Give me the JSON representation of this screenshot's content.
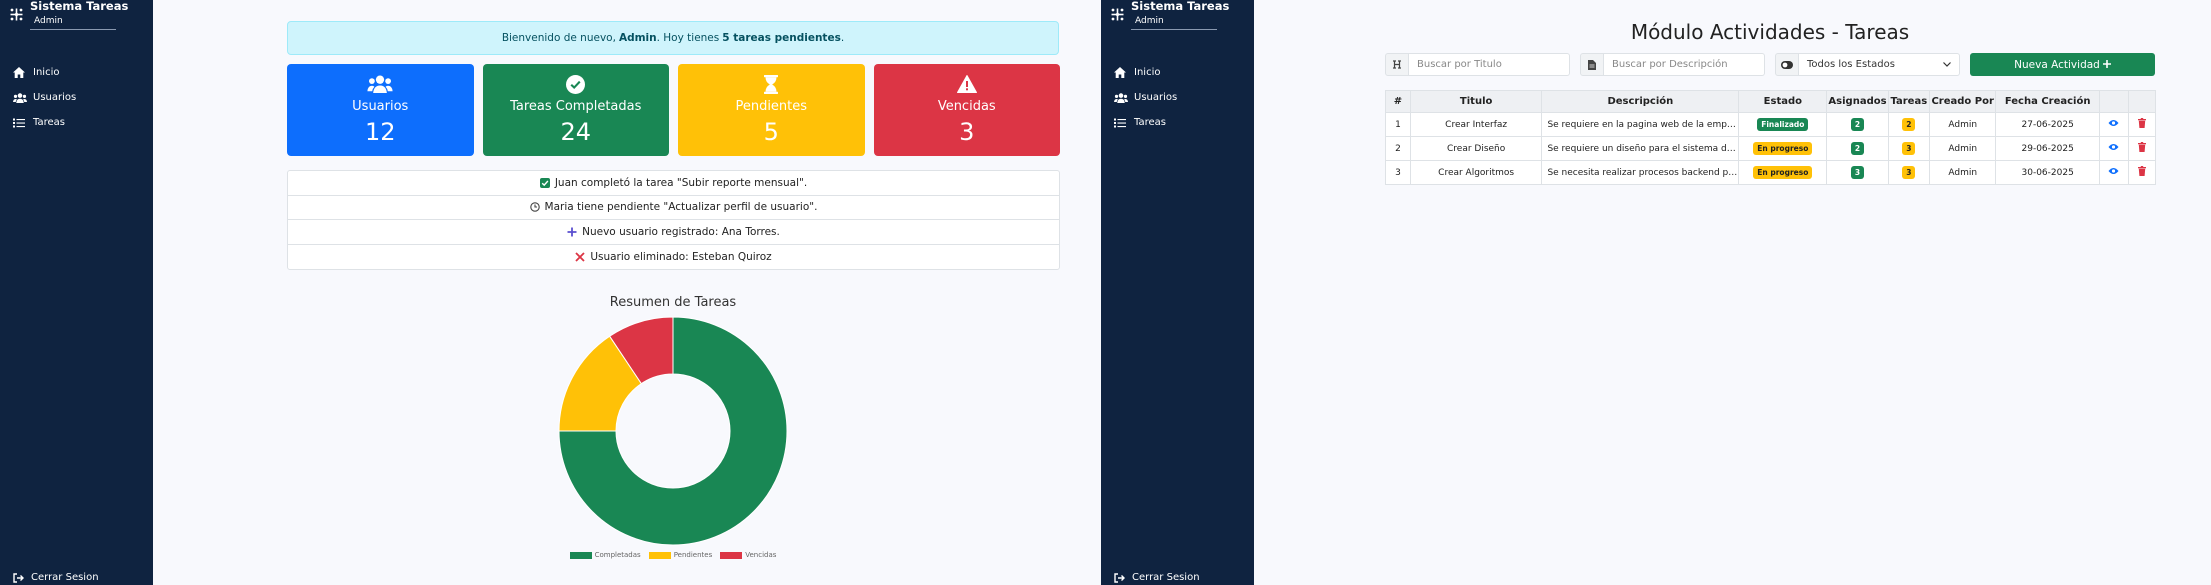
{
  "sidebar": {
    "title": "Sistema Tareas",
    "user": "Admin",
    "items": [
      {
        "label": "Inicio",
        "icon": "home-icon"
      },
      {
        "label": "Usuarios",
        "icon": "users-icon"
      },
      {
        "label": "Tareas",
        "icon": "list-icon"
      }
    ],
    "logout": "Cerrar Sesion"
  },
  "dashboard": {
    "alert": {
      "prefix": "Bienvenido de nuevo,",
      "user": "Admin",
      "middle": ". Hoy tienes",
      "count": "5 tareas pendientes",
      "suffix": "."
    },
    "cards": [
      {
        "label": "Usuarios",
        "value": "12",
        "icon": "users-icon",
        "color": "#0d6efd"
      },
      {
        "label": "Tareas Completadas",
        "value": "24",
        "icon": "check-circle-icon",
        "color": "#198754"
      },
      {
        "label": "Pendientes",
        "value": "5",
        "icon": "hourglass-icon",
        "color": "#ffc107"
      },
      {
        "label": "Vencidas",
        "value": "3",
        "icon": "warning-icon",
        "color": "#dc3545"
      }
    ],
    "activity": [
      {
        "text": "Juan completó la tarea \"Subir reporte mensual\".",
        "icon": "checkbox-icon"
      },
      {
        "text": "Maria tiene pendiente \"Actualizar perfil de usuario\".",
        "icon": "clock-icon"
      },
      {
        "text": "Nuevo usuario registrado: Ana Torres.",
        "icon": "plus-icon"
      },
      {
        "text": "Usuario eliminado: Esteban Quiroz",
        "icon": "x-icon"
      }
    ]
  },
  "chart_data": {
    "type": "pie",
    "title": "Resumen de Tareas",
    "categories": [
      "Completadas",
      "Pendientes",
      "Vencidas"
    ],
    "values": [
      24,
      5,
      3
    ],
    "colors": [
      "#198754",
      "#ffc107",
      "#dc3545"
    ],
    "donut": true,
    "legend": "bottom"
  },
  "tasks_panel": {
    "title": "Módulo Actividades - Tareas",
    "search_title_placeholder": "Buscar por Titulo",
    "search_desc_placeholder": "Buscar por Descripción",
    "status_filter": "Todos los Estados",
    "new_button": "Nueva Actividad",
    "columns": [
      "#",
      "Titulo",
      "Descripción",
      "Estado",
      "Asignados",
      "Tareas",
      "Creado Por",
      "Fecha Creación",
      "",
      ""
    ],
    "rows": [
      {
        "id": "1",
        "title": "Crear Interfaz",
        "description": "Se requiere en la pagina web de la empresa",
        "status": "Finalizado",
        "assigned": "2",
        "tasks": "2",
        "created_by": "Admin",
        "date": "27-06-2025"
      },
      {
        "id": "2",
        "title": "Crear Diseño",
        "description": "Se requiere un diseño para el sistema de gestión",
        "status": "En progreso",
        "assigned": "2",
        "tasks": "3",
        "created_by": "Admin",
        "date": "29-06-2025"
      },
      {
        "id": "3",
        "title": "Crear Algoritmos",
        "description": "Se necesita realizar procesos backend para el sistema",
        "status": "En progreso",
        "assigned": "3",
        "tasks": "3",
        "created_by": "Admin",
        "date": "30-06-2025"
      }
    ]
  },
  "colors": {
    "sidebar": "#0f2340",
    "success": "#198754",
    "warning": "#ffc107",
    "danger": "#dc3545",
    "primary": "#0d6efd"
  }
}
